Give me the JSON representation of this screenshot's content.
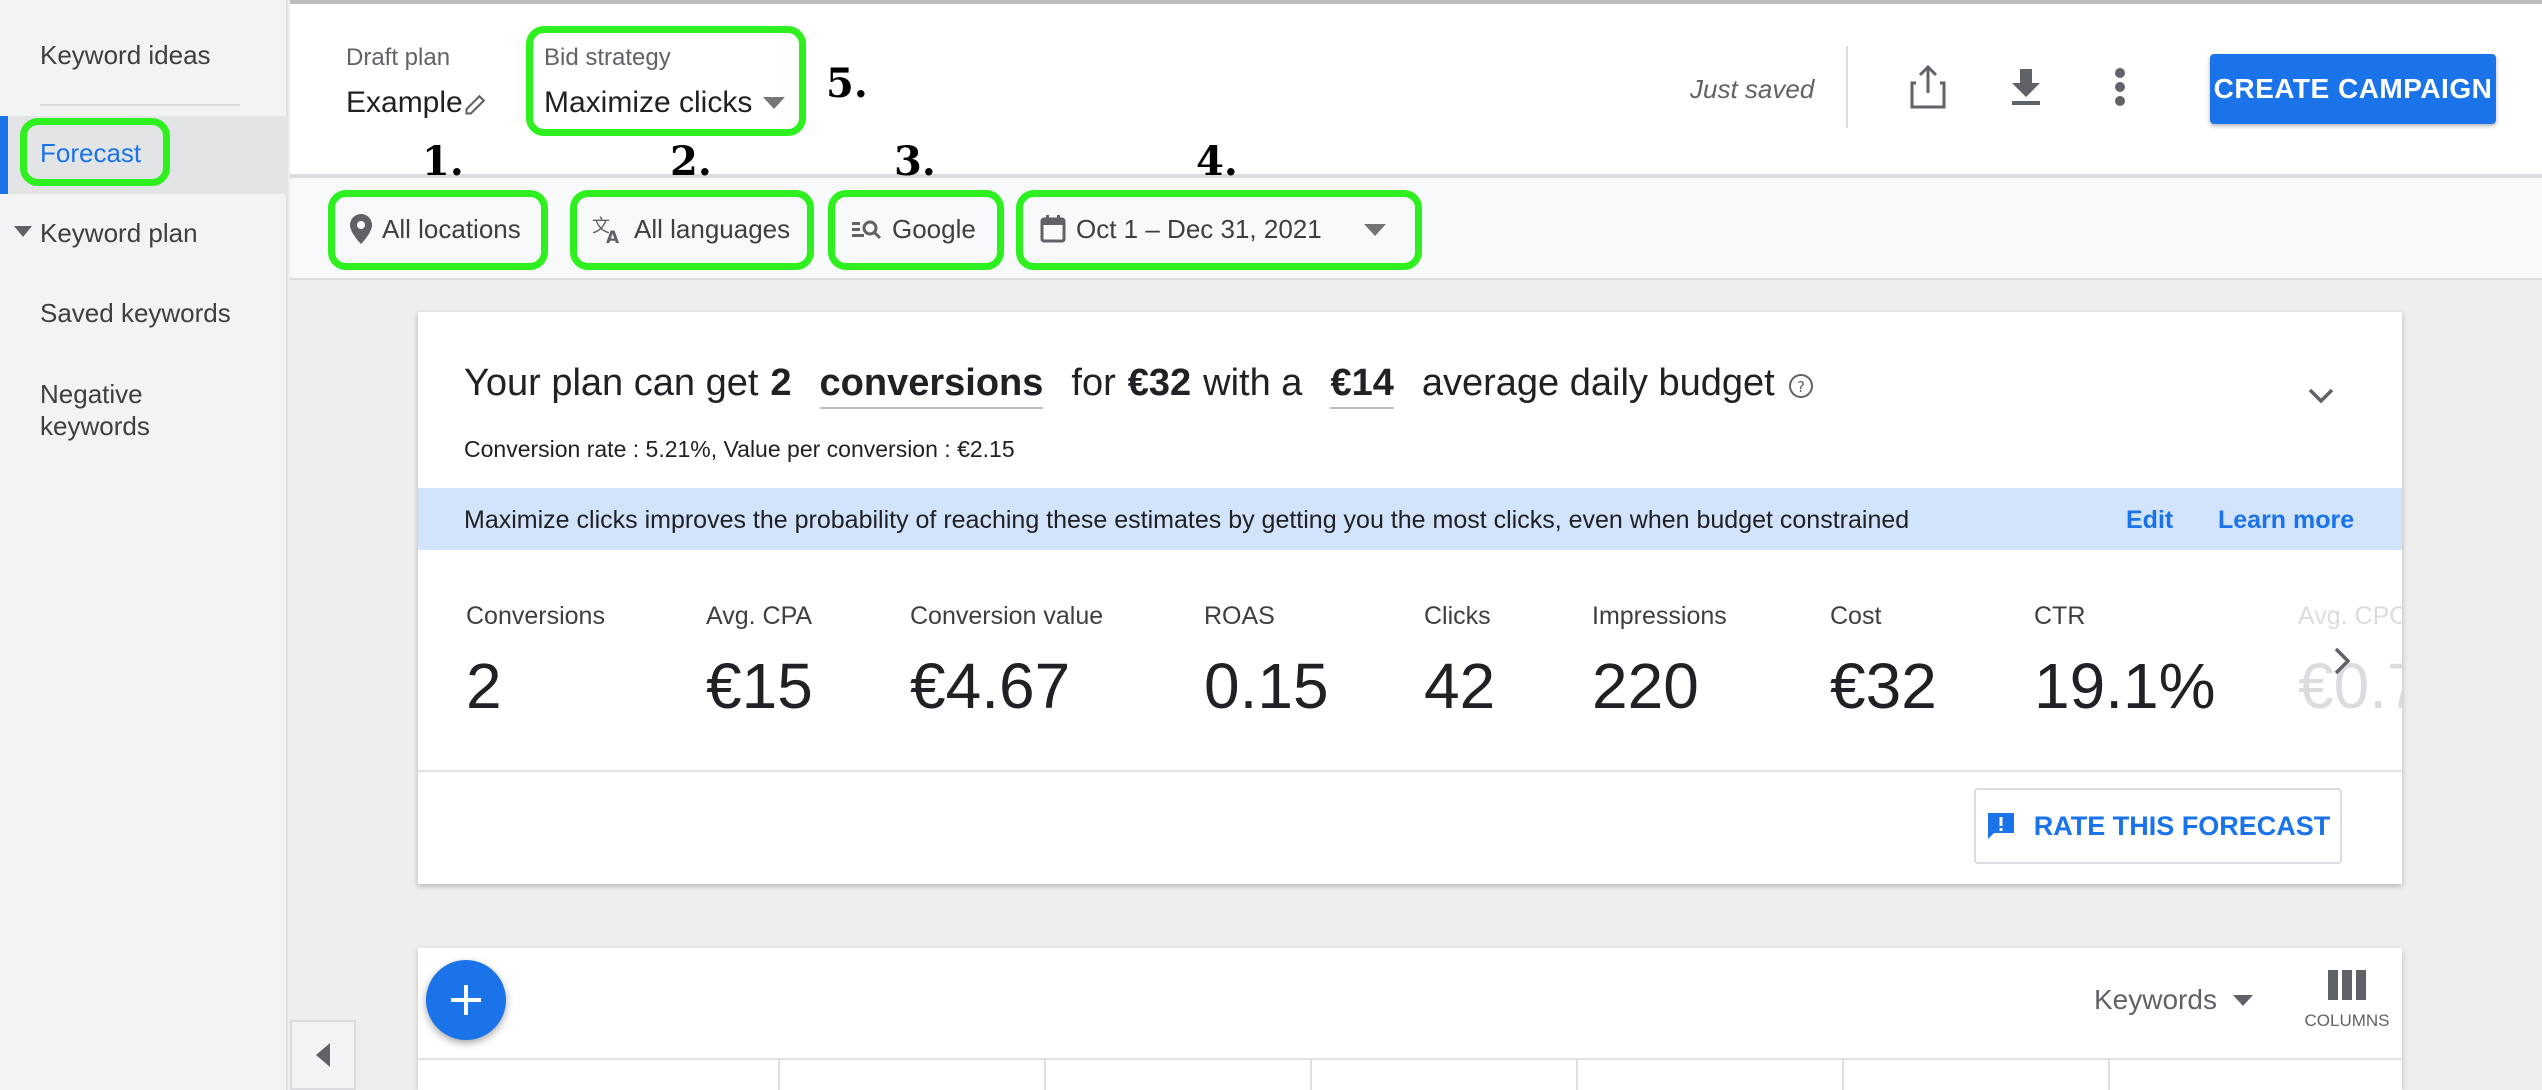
{
  "sidebar": {
    "items": [
      {
        "label": "Keyword ideas"
      },
      {
        "label": "Forecast"
      },
      {
        "label": "Keyword plan"
      },
      {
        "label": "Saved keywords"
      },
      {
        "label": "Negative keywords"
      }
    ]
  },
  "header": {
    "plan_label": "Draft plan",
    "plan_name": "Example",
    "bid_label": "Bid strategy",
    "bid_value": "Maximize clicks",
    "save_status": "Just saved",
    "create_button": "CREATE CAMPAIGN"
  },
  "filters": {
    "location": "All locations",
    "language": "All languages",
    "network": "Google",
    "date_range": "Oct 1 – Dec 31, 2021"
  },
  "annotations": [
    "1.",
    "2.",
    "3.",
    "4.",
    "5."
  ],
  "forecast": {
    "headline": {
      "p1": "Your plan can get",
      "count": "2",
      "metric": "conversions",
      "p2": "for",
      "cost": "€32",
      "p3": "with a",
      "budget": "€14",
      "p4": "average daily budget"
    },
    "subline": "Conversion rate : 5.21%, Value per conversion : €2.15",
    "banner": "Maximize clicks improves the probability of reaching these estimates by getting you the most clicks, even when budget constrained",
    "edit_link": "Edit",
    "learn_link": "Learn more",
    "metrics": [
      {
        "label": "Conversions",
        "value": "2"
      },
      {
        "label": "Avg. CPA",
        "value": "€15"
      },
      {
        "label": "Conversion value",
        "value": "€4.67"
      },
      {
        "label": "ROAS",
        "value": "0.15"
      },
      {
        "label": "Clicks",
        "value": "42"
      },
      {
        "label": "Impressions",
        "value": "220"
      },
      {
        "label": "Cost",
        "value": "€32"
      },
      {
        "label": "CTR",
        "value": "19.1%"
      },
      {
        "label": "Avg. CPC",
        "value": "€0.7"
      }
    ],
    "rate_button": "RATE THIS FORECAST"
  },
  "table": {
    "keywords_select": "Keywords",
    "columns_label": "COLUMNS"
  },
  "colors": {
    "accent": "#1a73e8",
    "highlight": "#2ef01f",
    "banner": "#d2e3fc"
  }
}
